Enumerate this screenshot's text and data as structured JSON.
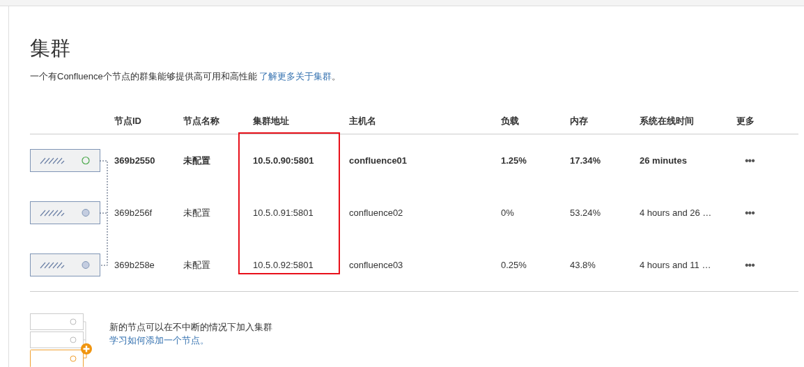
{
  "title": "集群",
  "description": {
    "text": "一个有Confluence个节点的群集能够提供高可用和高性能",
    "link": "了解更多关于集群",
    "end": "。"
  },
  "table": {
    "columns": [
      {
        "label": "节点ID",
        "highlighted": false
      },
      {
        "label": "节点名称",
        "highlighted": false
      },
      {
        "label": "集群地址",
        "highlighted": true
      },
      {
        "label": "主机名",
        "highlighted": false
      },
      {
        "label": "负载",
        "highlighted": false
      },
      {
        "label": "内存",
        "highlighted": false
      },
      {
        "label": "系统在线时间",
        "highlighted": false
      },
      {
        "label": "更多",
        "highlighted": false
      }
    ],
    "rows": [
      {
        "current": true,
        "cells": [
          "369b2550",
          "未配置",
          "10.5.0.90:5801",
          "confluence01",
          "1.25%",
          "17.34%",
          "26 minutes"
        ],
        "more": "•••"
      },
      {
        "current": false,
        "cells": [
          "369b256f",
          "未配置",
          "10.5.0.91:5801",
          "confluence02",
          "0%",
          "53.24%",
          "4 hours and 26 …"
        ],
        "more": "•••"
      },
      {
        "current": false,
        "cells": [
          "369b258e",
          "未配置",
          "10.5.0.92:5801",
          "confluence03",
          "0.25%",
          "43.8%",
          "4 hours and 11 …"
        ],
        "more": "•••"
      }
    ]
  },
  "footer": {
    "text": "新的节点可以在不中断的情况下加入集群",
    "link": "学习如何添加一个节点。"
  }
}
